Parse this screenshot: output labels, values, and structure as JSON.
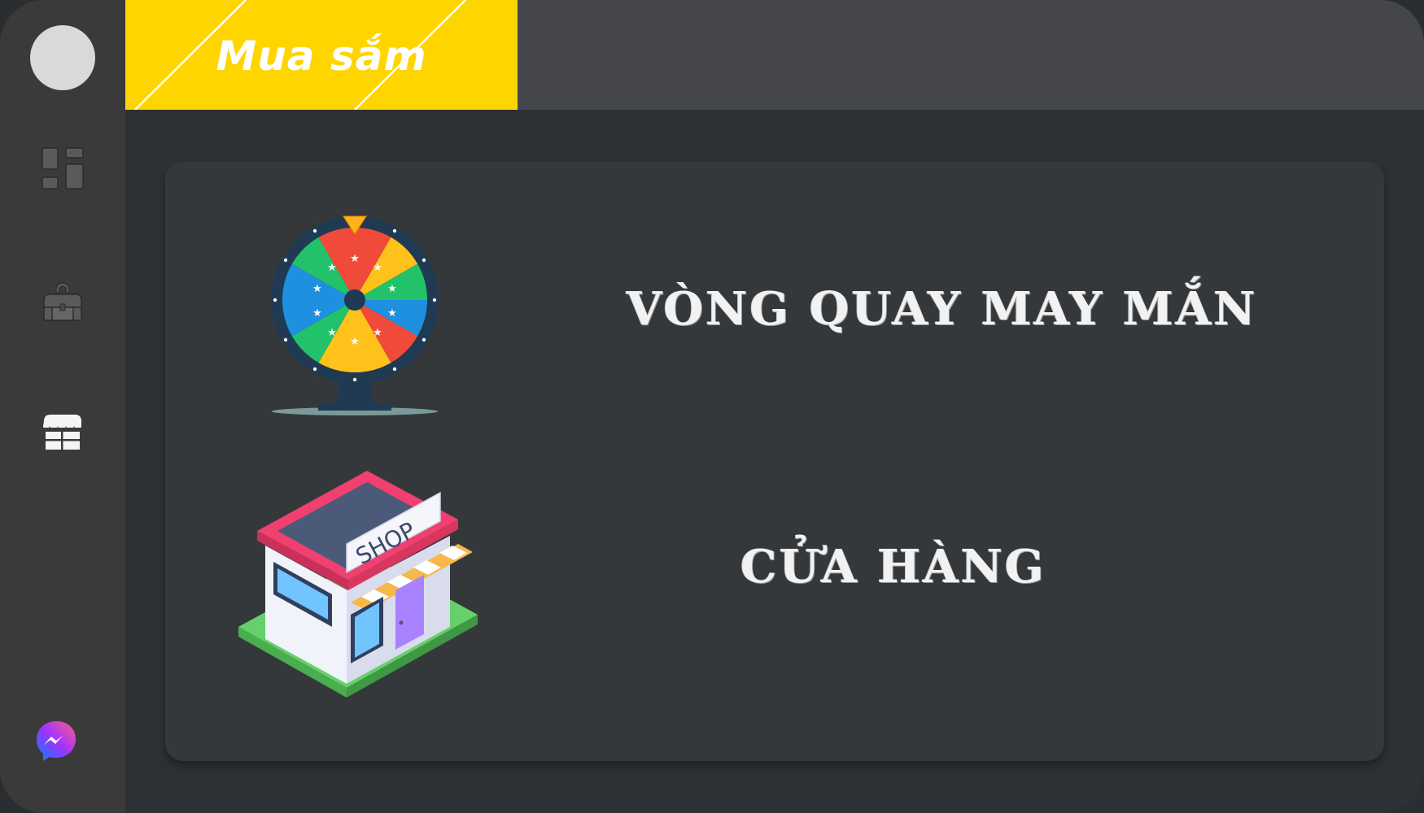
{
  "header": {
    "active_tab_label": "Mua sắm"
  },
  "sidebar": {
    "items": [
      {
        "name": "avatar"
      },
      {
        "icon": "dashboard-icon"
      },
      {
        "icon": "backpack-icon"
      },
      {
        "icon": "store-icon"
      }
    ],
    "footer_icon": "messenger-icon"
  },
  "main": {
    "items": [
      {
        "title": "VÒNG QUAY MAY MẮN",
        "icon": "prize-wheel-image"
      },
      {
        "title": "CỬA HÀNG",
        "icon": "shop-building-image",
        "sign_text": "SHOP"
      }
    ]
  },
  "colors": {
    "accent": "#ffd500",
    "sidebar": "#3a3a3b",
    "topbar": "#44464b",
    "panel": "#35383b",
    "background": "#2e3134"
  }
}
